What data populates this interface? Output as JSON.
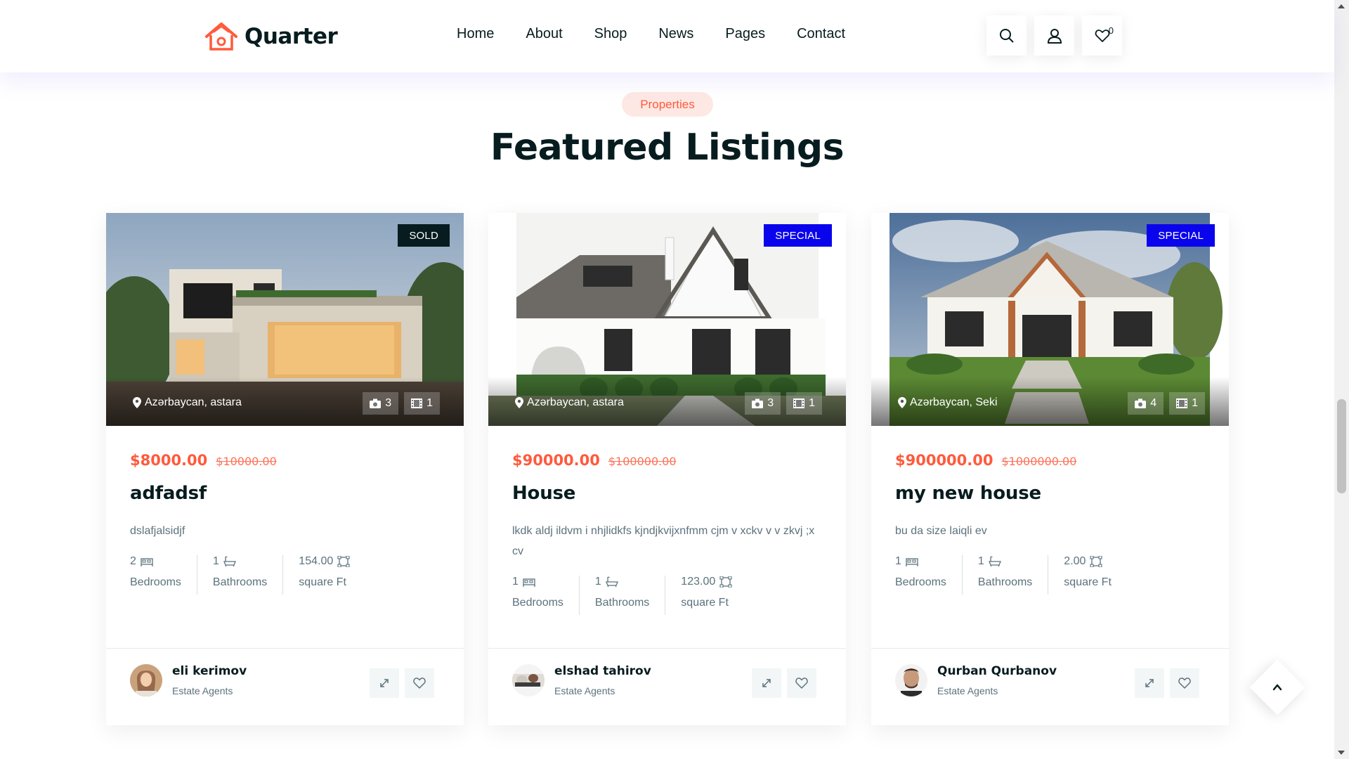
{
  "header": {
    "logo_text": "Quarter",
    "nav": [
      "Home",
      "About",
      "Shop",
      "News",
      "Pages",
      "Contact"
    ],
    "wishlist_count": "0",
    "icons": [
      "search-icon",
      "user-icon",
      "heart-icon"
    ]
  },
  "section": {
    "badge": "Properties",
    "title": "Featured Listings"
  },
  "colors": {
    "accent": "#ff5a3c",
    "dark": "#071c1f",
    "special_tag": "#0a04ec",
    "sold_tag": "#071c1f"
  },
  "listings": [
    {
      "tag": "SOLD",
      "location": "Azərbaycan, astara",
      "photos": "3",
      "videos": "1",
      "price": "$8000.00",
      "old_price": "$10000.00",
      "title": "adfadsf",
      "description": "dslafjalsidjf",
      "bedrooms": "2",
      "bathrooms": "1",
      "area": "154.00",
      "bedrooms_label": "Bedrooms",
      "bathrooms_label": "Bathrooms",
      "area_label": "square Ft",
      "agent_name": "eli kerimov",
      "agent_role": "Estate Agents"
    },
    {
      "tag": "SPECIAL",
      "location": "Azərbaycan, astara",
      "photos": "3",
      "videos": "1",
      "price": "$90000.00",
      "old_price": "$100000.00",
      "title": "House",
      "description": "lkdk aldj ildvm i nhjlidkfs kjndjkvijxnfmm cjm v xckv v v zkvj ;x cv",
      "bedrooms": "1",
      "bathrooms": "1",
      "area": "123.00",
      "bedrooms_label": "Bedrooms",
      "bathrooms_label": "Bathrooms",
      "area_label": "square Ft",
      "agent_name": "elshad tahirov",
      "agent_role": "Estate Agents"
    },
    {
      "tag": "SPECIAL",
      "location": "Azərbaycan, Seki",
      "photos": "4",
      "videos": "1",
      "price": "$900000.00",
      "old_price": "$1000000.00",
      "title": "my new house",
      "description": "bu da size laiqli ev",
      "bedrooms": "1",
      "bathrooms": "1",
      "area": "2.00",
      "bedrooms_label": "Bedrooms",
      "bathrooms_label": "Bathrooms",
      "area_label": "square Ft",
      "agent_name": "Qurban Qurbanov",
      "agent_role": "Estate Agents"
    }
  ]
}
